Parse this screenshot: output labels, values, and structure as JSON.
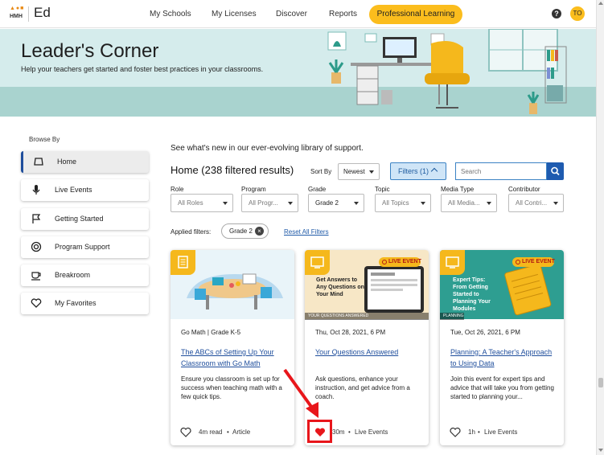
{
  "brand": {
    "logo_text": "HMH",
    "app_name": "Ed"
  },
  "nav": {
    "items": [
      "My Schools",
      "My Licenses",
      "Discover",
      "Reports"
    ],
    "active_pill": "Professional Learning",
    "help": "?",
    "avatar": "TO"
  },
  "hero": {
    "title": "Leader's Corner",
    "subtitle": "Help your teachers get started and foster best practices in your classrooms."
  },
  "sidebar": {
    "title": "Browse By",
    "items": [
      {
        "label": "Home",
        "icon": "home-icon",
        "active": true
      },
      {
        "label": "Live Events",
        "icon": "microphone-icon"
      },
      {
        "label": "Getting Started",
        "icon": "flag-icon"
      },
      {
        "label": "Program Support",
        "icon": "lifebuoy-icon"
      },
      {
        "label": "Breakroom",
        "icon": "coffee-cup-icon"
      },
      {
        "label": "My Favorites",
        "icon": "heart-icon"
      }
    ]
  },
  "main": {
    "intro": "See what's new in our ever-evolving library of support.",
    "results_title": "Home (238 filtered results)",
    "sort_label": "Sort By",
    "sort_value": "Newest",
    "filters_button": "Filters (1)",
    "search_placeholder": "Search",
    "filters": [
      {
        "label": "Role",
        "value": "All Roles"
      },
      {
        "label": "Program",
        "value": "All Progr..."
      },
      {
        "label": "Grade",
        "value": "Grade 2"
      },
      {
        "label": "Topic",
        "value": "All Topics"
      },
      {
        "label": "Media Type",
        "value": "All Media..."
      },
      {
        "label": "Contributor",
        "value": "All Contri..."
      }
    ],
    "applied_label": "Applied filters:",
    "applied_chip": "Grade 2",
    "reset_link": "Reset All Filters"
  },
  "cards": [
    {
      "meta": "Go Math  |  Grade K-5",
      "title": "The ABCs of Setting Up Your Classroom with Go Math",
      "desc": "Ensure you classroom is set up for success when teaching math with a few quick tips.",
      "duration": "4m read",
      "type": "Article"
    },
    {
      "badge": "LIVE EVENT",
      "img_text": "Get Answers to Any Questions on Your Mind",
      "strip": "YOUR QUESTIONS ANSWERED",
      "meta": "Thu, Oct 28, 2021, 6 PM",
      "title": "Your Questions Answered",
      "desc": "Ask questions, enhance your instruction, and get advice from a coach.",
      "duration": "30m",
      "type": "Live Events"
    },
    {
      "badge": "LIVE EVENT",
      "img_text": "Expert Tips: From Getting Started to Planning Your Modules",
      "strip": "PLANNING",
      "meta": "Tue, Oct 26, 2021, 6 PM",
      "title": "Planning: A Teacher's Approach to Using Data",
      "desc": "Join this event for expert tips and advice that will take you from getting started to planning your...",
      "duration": "1h",
      "type": "Live Events"
    }
  ],
  "colors": {
    "accent": "#fbbd1d",
    "link": "#1f4e9c",
    "highlight": "#e8161b"
  }
}
